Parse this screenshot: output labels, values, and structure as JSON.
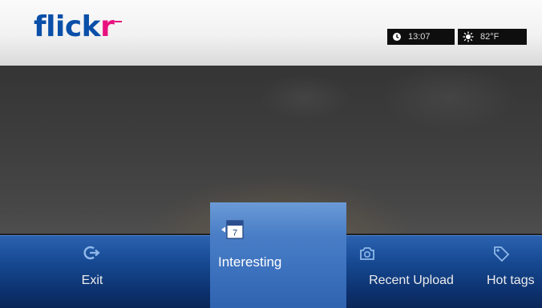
{
  "app": {
    "logo_part1": "flick",
    "logo_part2": "r"
  },
  "status": {
    "time": "13:07",
    "weather": "82°F",
    "clock_icon": "clock-icon",
    "weather_icon": "sun-icon"
  },
  "menu": {
    "items": [
      {
        "label": "Exit",
        "icon": "exit-icon"
      },
      {
        "label": "Interesting",
        "icon": "calendar-icon",
        "selected": true
      },
      {
        "label": "Recent Upload",
        "icon": "photo-upload-icon"
      },
      {
        "label": "Hot tags",
        "icon": "tag-icon"
      }
    ]
  },
  "colors": {
    "brand_blue": "#0a4fa8",
    "brand_pink": "#e8117f",
    "menu_bar": "#174a93",
    "menu_selected": "#4a7fc7"
  }
}
